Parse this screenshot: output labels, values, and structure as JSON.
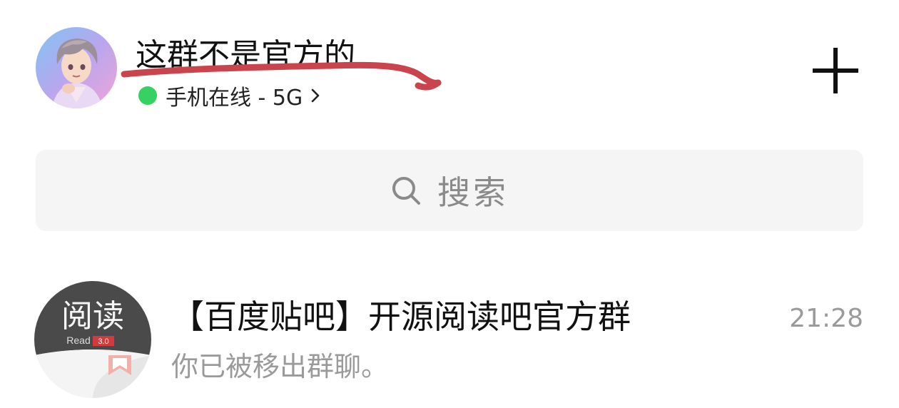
{
  "header": {
    "title": "这群不是官方的",
    "status": {
      "text": "手机在线 - 5G",
      "dot_color": "#35d162"
    },
    "add_icon": "plus-icon",
    "scribble_color": "#c9444c"
  },
  "search": {
    "placeholder": "搜索",
    "icon": "search-icon"
  },
  "conversations": [
    {
      "title": "【百度贴吧】开源阅读吧官方群",
      "time": "21:28",
      "preview": "你已被移出群聊。",
      "avatar": {
        "text_main": "阅读",
        "text_read": "Read",
        "badge": "3.0"
      }
    }
  ]
}
